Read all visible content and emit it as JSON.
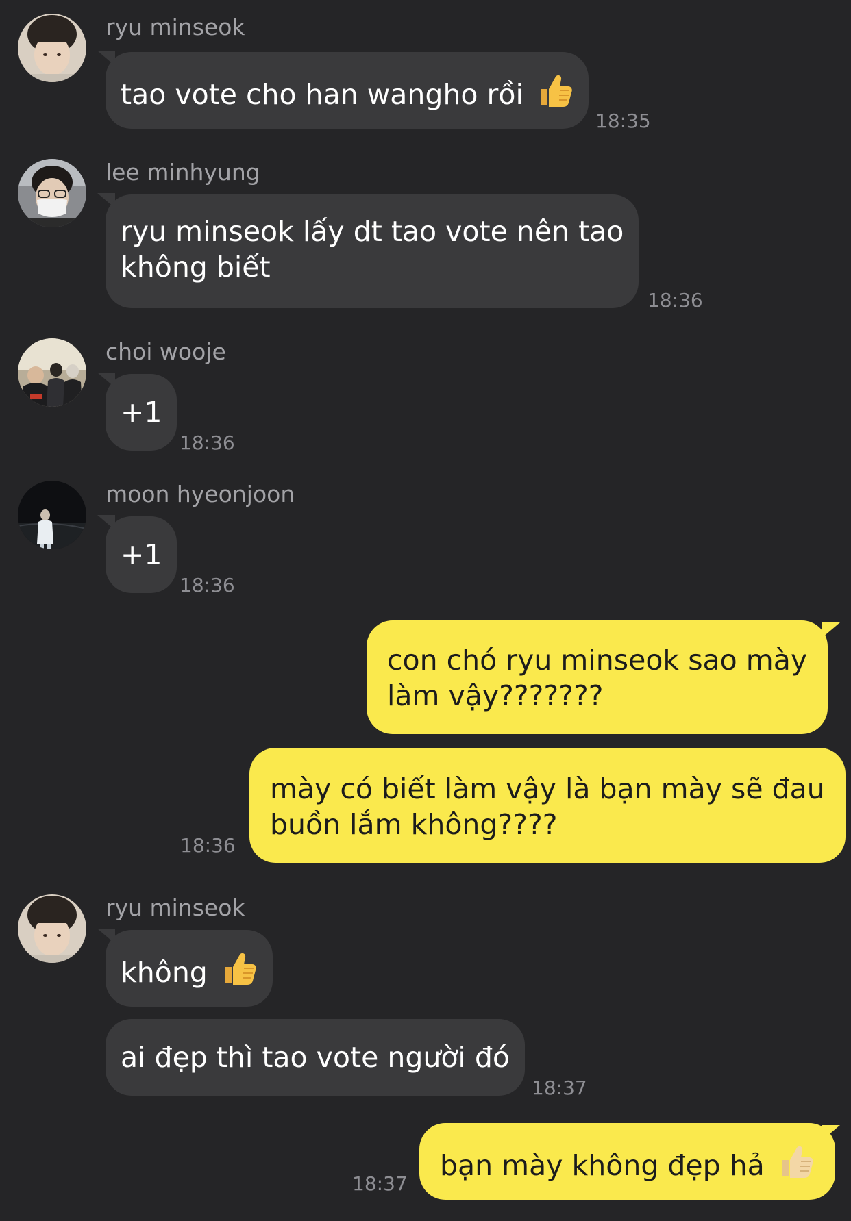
{
  "colors": {
    "background": "#252527",
    "incoming_bubble": "#3a3a3c",
    "outgoing_bubble": "#fae94d",
    "sender_name": "#a3a3a7",
    "timestamp": "#8e8e93"
  },
  "messages": [
    {
      "sender": "ryu minseok",
      "text": "tao vote cho han wangho rồi",
      "emoji": "thumbs-up",
      "time": "18:35"
    },
    {
      "sender": "lee minhyung",
      "lines": [
        "ryu minseok lấy dt tao vote nên tao",
        "không biết"
      ],
      "time": "18:36"
    },
    {
      "sender": "choi wooje",
      "text": "+1",
      "time": "18:36"
    },
    {
      "sender": "moon hyeonjoon",
      "text": "+1",
      "time": "18:36"
    },
    {
      "outgoing": true,
      "lines": [
        "con chó ryu minseok sao mày",
        "làm vậy???????"
      ]
    },
    {
      "outgoing": true,
      "lines": [
        "mày có biết làm vậy là bạn mày sẽ đau",
        "buồn lắm không????"
      ],
      "time": "18:36"
    },
    {
      "sender": "ryu minseok",
      "text": "không",
      "emoji": "thumbs-up"
    },
    {
      "text": "ai đẹp thì tao vote người đó",
      "time": "18:37"
    },
    {
      "outgoing": true,
      "text": "bạn mày không đẹp hả",
      "emoji": "thumbs-up",
      "time": "18:37"
    }
  ]
}
